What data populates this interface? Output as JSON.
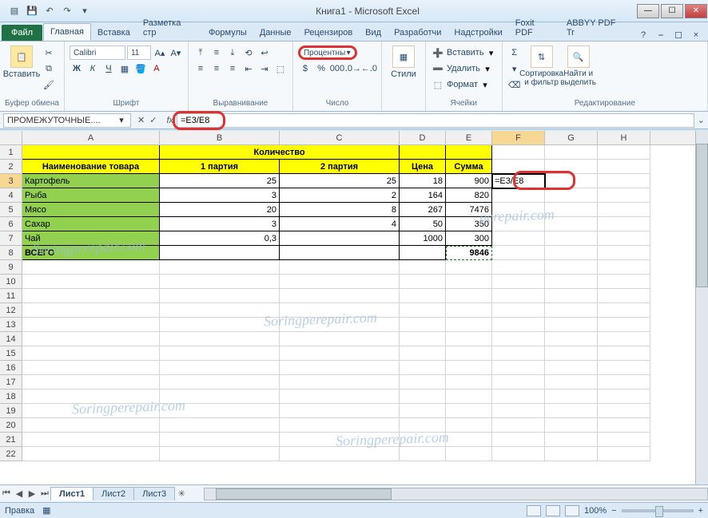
{
  "title": "Книга1  -  Microsoft Excel",
  "tabs": {
    "file": "Файл",
    "list": [
      "Главная",
      "Вставка",
      "Разметка стр",
      "Формулы",
      "Данные",
      "Рецензиров",
      "Вид",
      "Разработчи",
      "Надстройки",
      "Foxit PDF",
      "ABBYY PDF Tr"
    ],
    "active": 0
  },
  "ribbon": {
    "clipboard": {
      "label": "Буфер обмена",
      "paste": "Вставить"
    },
    "font": {
      "label": "Шрифт",
      "name": "Calibri",
      "size": "11"
    },
    "alignment": {
      "label": "Выравнивание"
    },
    "number": {
      "label": "Число",
      "format": "Процентны"
    },
    "styles": {
      "label": "",
      "btn": "Стили"
    },
    "cells": {
      "label": "Ячейки",
      "insert": "Вставить",
      "delete": "Удалить",
      "format": "Формат"
    },
    "editing": {
      "label": "Редактирование",
      "sort": "Сортировка\nи фильтр",
      "find": "Найти и\nвыделить"
    }
  },
  "formula_bar": {
    "namebox": "ПРОМЕЖУТОЧНЫЕ....",
    "formula": "=E3/E8"
  },
  "columns": [
    "A",
    "B",
    "C",
    "D",
    "E",
    "F",
    "G",
    "H"
  ],
  "sheet": {
    "header1": {
      "name": "Наименование товара",
      "qty": "Количество",
      "p1": "1 партия",
      "p2": "2 партия",
      "price": "Цена",
      "sum": "Сумма"
    },
    "rows": [
      {
        "name": "Картофель",
        "p1": "25",
        "p2": "25",
        "price": "18",
        "sum": "900"
      },
      {
        "name": "Рыба",
        "p1": "3",
        "p2": "2",
        "price": "164",
        "sum": "820"
      },
      {
        "name": "Мясо",
        "p1": "20",
        "p2": "8",
        "price": "267",
        "sum": "7476"
      },
      {
        "name": "Сахар",
        "p1": "3",
        "p2": "4",
        "price": "50",
        "sum": "350"
      },
      {
        "name": "Чай",
        "p1": "0,3",
        "p2": "",
        "price": "1000",
        "sum": "300"
      }
    ],
    "total": {
      "name": "ВСЕГО",
      "sum": "9846"
    },
    "active_cell": {
      "ref": "F3",
      "display": "=E3/E8"
    }
  },
  "sheets": [
    "Лист1",
    "Лист2",
    "Лист3"
  ],
  "status": {
    "mode": "Правка",
    "zoom": "100%"
  },
  "chart_data": null
}
